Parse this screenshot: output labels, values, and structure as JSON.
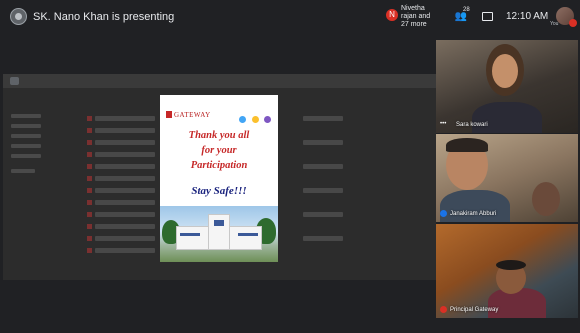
{
  "topbar": {
    "presenting_text": "SK. Nano Khan is presenting",
    "host_initial": "N",
    "host_text": "Nivetha rajan and 27 more",
    "people_count": "28",
    "time": "12:10 AM",
    "self_label": "You"
  },
  "slide": {
    "logo_text": "GATEWAY",
    "line1": "Thank you all",
    "line2": "for your",
    "line3": "Participation",
    "line4": "Stay Safe!!!"
  },
  "participants": [
    {
      "name": "Sara kowari",
      "mic": "dots"
    },
    {
      "name": "Janakiram Abburi",
      "mic": "active"
    },
    {
      "name": "Principal Gateway",
      "mic": "muted"
    }
  ],
  "colors": {
    "background": "#202124",
    "accent_red": "#d93025",
    "slide_red": "#c62828",
    "slide_blue": "#1a237e"
  }
}
